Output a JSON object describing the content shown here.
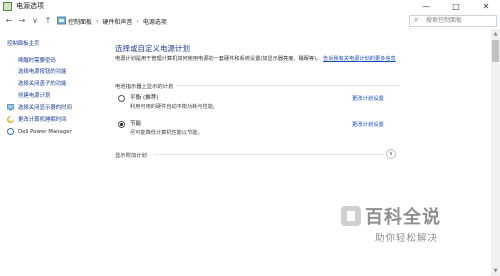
{
  "window": {
    "title": "电源选项",
    "minimize_glyph": "—",
    "maximize_glyph": "□",
    "close_glyph": "✕"
  },
  "addressbar": {
    "back": "←",
    "forward": "→",
    "dropdown": "∨",
    "up": "↑",
    "crumbs": [
      "控制面板",
      "硬件和声音",
      "电源选项"
    ],
    "separator": "›",
    "search_placeholder": "搜索控制面板",
    "search_glyph": "⌕"
  },
  "sidebar": {
    "home": "控制面板主页",
    "items": [
      "唤醒时需要密码",
      "选择电源按钮的功能",
      "选择关闭盖子的功能",
      "创建电源计划",
      "选择关闭显示器的时间",
      "更改计算机睡眠时间",
      "Dell Power Manager"
    ]
  },
  "main": {
    "heading": "选择或自定义电源计划",
    "description": "电源计划是用于管理计算机如何使用电源的一套硬件和系统设置(如显示器亮度、睡眠等)。",
    "description_link": "告诉我有关电源计划的更多信息",
    "section_label": "电池指示器上显示的计划",
    "plans": [
      {
        "name": "平衡 (推荐)",
        "desc": "利用可用的硬件自动平衡功耗与性能。",
        "link": "更改计划设置",
        "selected": false
      },
      {
        "name": "节能",
        "desc": "尽可能降低计算机性能以节能。",
        "link": "更改计划设置",
        "selected": true
      }
    ],
    "more_plans_label": "显示附加计划",
    "chevron": "∨"
  },
  "scrollbar": {
    "up": "▲",
    "down": "▼"
  },
  "watermark": {
    "title": "百科全说",
    "subtitle": "助你轻松解决"
  }
}
